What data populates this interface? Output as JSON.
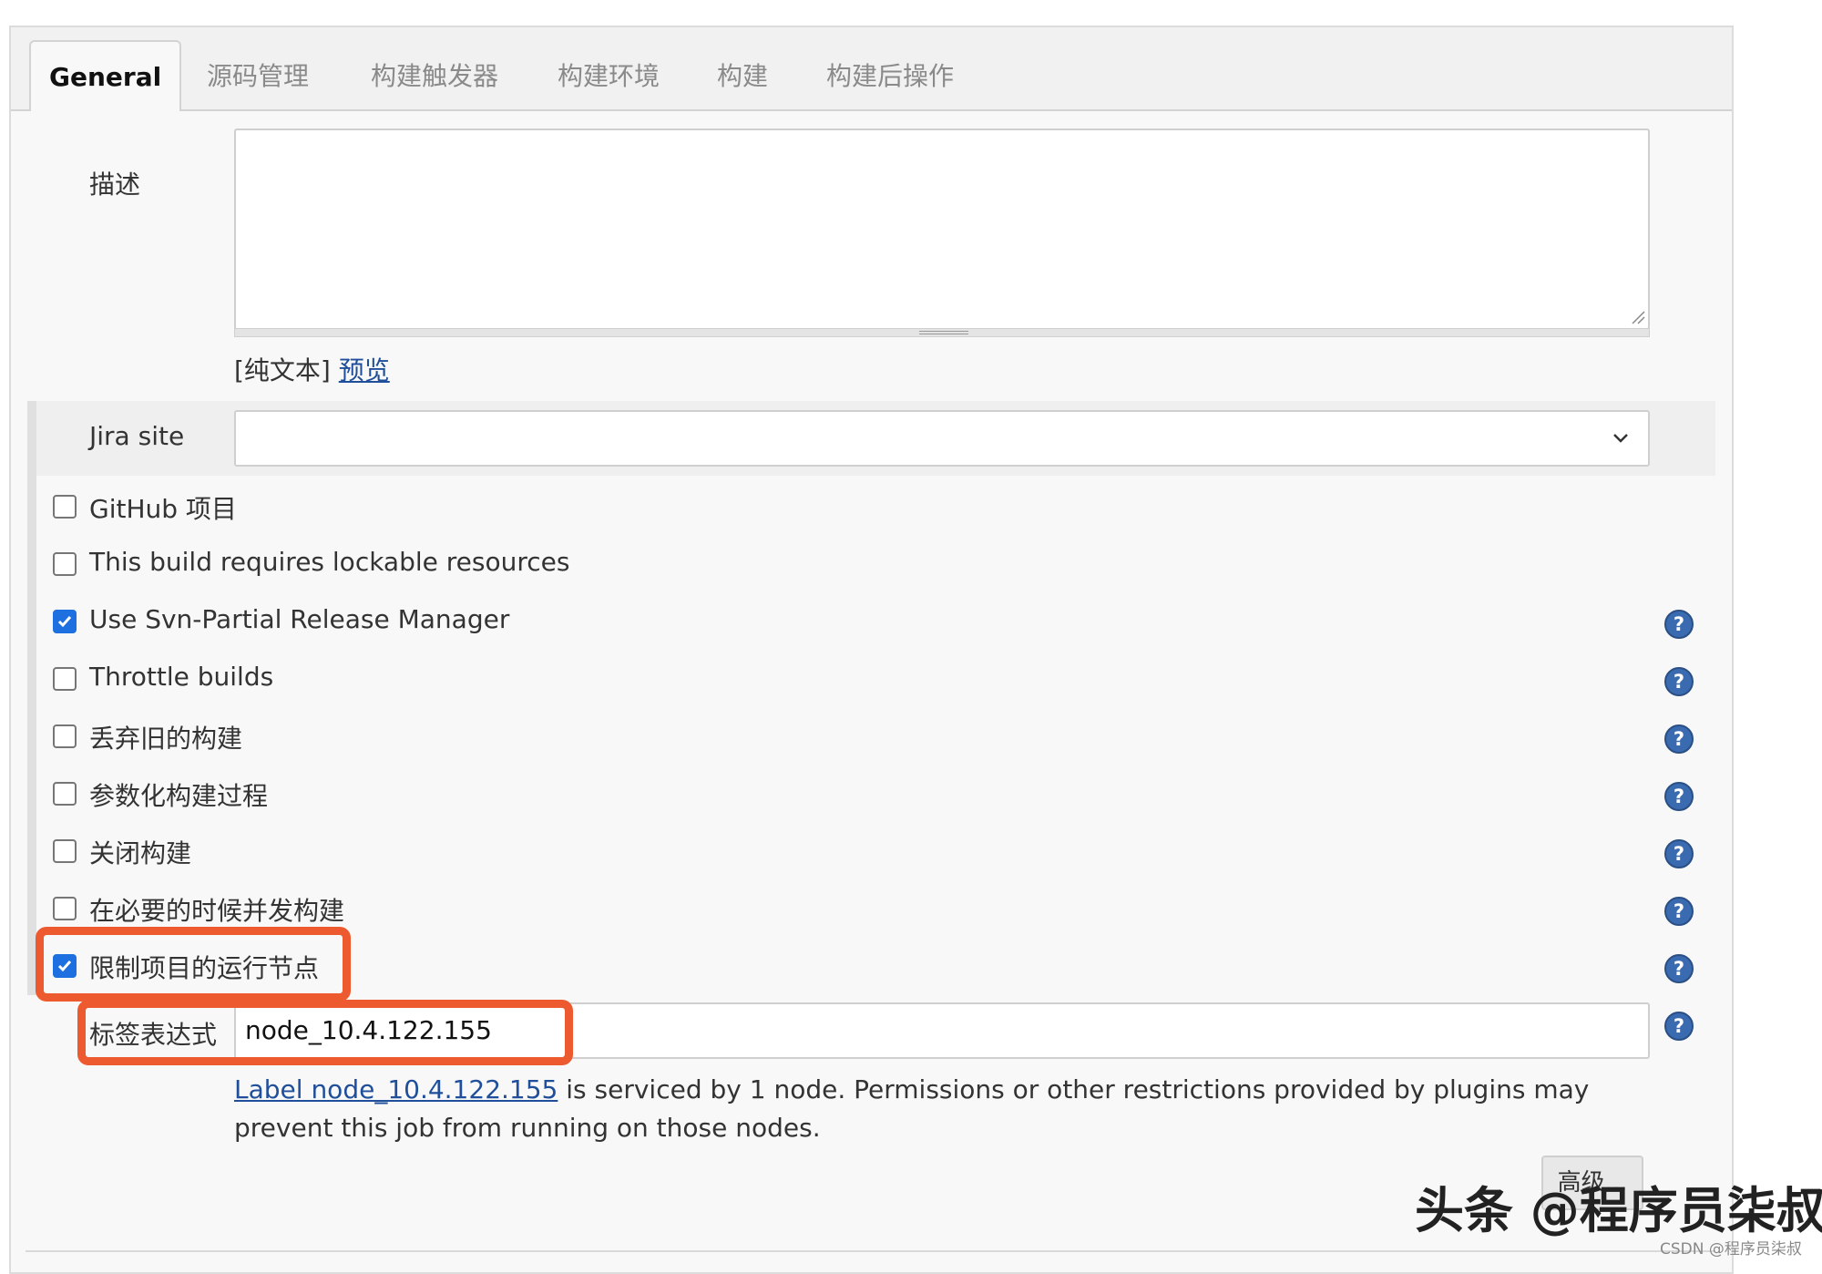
{
  "tabs": [
    {
      "label": "General",
      "active": true
    },
    {
      "label": "源码管理"
    },
    {
      "label": "构建触发器"
    },
    {
      "label": "构建环境"
    },
    {
      "label": "构建"
    },
    {
      "label": "构建后操作"
    }
  ],
  "description": {
    "label": "描述",
    "value": "",
    "format_prefix": "[纯文本]",
    "preview_link": "预览"
  },
  "jira": {
    "label": "Jira site",
    "value": ""
  },
  "options": [
    {
      "label": "GitHub 项目",
      "checked": false,
      "help": false
    },
    {
      "label": "This build requires lockable resources",
      "checked": false,
      "help": false
    },
    {
      "label": "Use Svn-Partial Release Manager",
      "checked": true,
      "help": true
    },
    {
      "label": "Throttle builds",
      "checked": false,
      "help": true
    },
    {
      "label": "丢弃旧的构建",
      "checked": false,
      "help": true
    },
    {
      "label": "参数化构建过程",
      "checked": false,
      "help": true
    },
    {
      "label": "关闭构建",
      "checked": false,
      "help": true
    },
    {
      "label": "在必要的时候并发构建",
      "checked": false,
      "help": true
    },
    {
      "label": "限制项目的运行节点",
      "checked": true,
      "help": true
    }
  ],
  "label_expression": {
    "label": "标签表达式",
    "value": "node_10.4.122.155",
    "info_link": "Label node_10.4.122.155",
    "info_text": " is serviced by 1 node. Permissions or other restrictions provided by plugins may prevent this job from running on those nodes."
  },
  "advanced_button": "高级...",
  "watermark": {
    "main": "头条 @程序员柒叔",
    "small": "CSDN @程序员柒叔"
  },
  "colors": {
    "highlight": "#ee5a2f",
    "checkbox": "#1e6fe0",
    "help": "#3a6bb0",
    "link": "#1f4f9a"
  }
}
